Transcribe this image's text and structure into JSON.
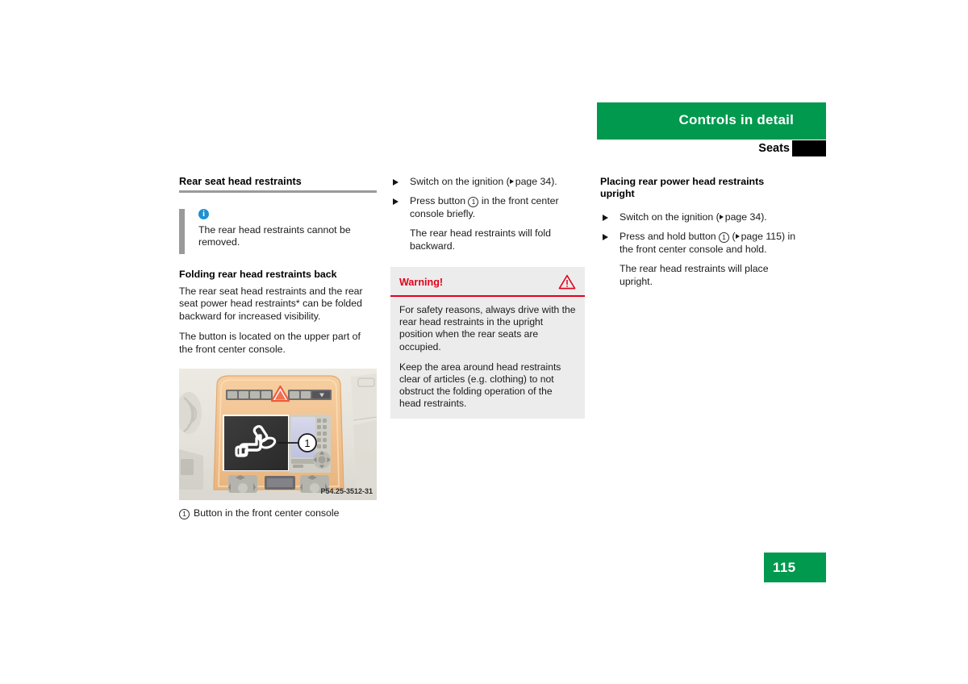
{
  "header": {
    "title": "Controls in detail",
    "subtitle": "Seats",
    "bar_color": "#00994d"
  },
  "left_column": {
    "section_title": "Rear seat head restraints",
    "note": {
      "icon": "info-icon",
      "text": "The rear head restraints cannot be removed."
    },
    "sub_title": "Folding rear head restraints back",
    "paragraph_1": "The rear seat head restraints and the rear seat power head restraints* can be folded backward for increased visibility.",
    "paragraph_2": "The button is located on the upper part of the front center console.",
    "figure": {
      "code": "P54.25-3512-31",
      "callout_number": "1",
      "caption_number": "1",
      "caption_text": "Button in the front center console"
    }
  },
  "middle_column": {
    "steps": [
      {
        "marker": "triangle-bullet",
        "text_before": "Switch on the ignition (",
        "ref": "page 34",
        "text_after": ")."
      },
      {
        "marker": "triangle-bullet",
        "text_before": "Press button ",
        "circled": "1",
        "text_after": " in the front center console briefly."
      }
    ],
    "result": "The rear head restraints will fold backward.",
    "warning": {
      "title": "Warning!",
      "icon": "warning-triangle-icon",
      "paragraph_1": "For safety reasons, always drive with the rear head restraints in the upright position when the rear seats are occupied.",
      "paragraph_2": "Keep the area around head restraints clear of articles (e.g. clothing) to not obstruct the folding operation of the head restraints.",
      "accent_color": "#e2001a"
    }
  },
  "right_column": {
    "sub_title": "Placing rear power head restraints upright",
    "steps": [
      {
        "marker": "triangle-bullet",
        "text_before": "Switch on the ignition (",
        "ref": "page 34",
        "text_after": ")."
      },
      {
        "marker": "triangle-bullet",
        "text_before": "Press and hold button ",
        "circled": "1",
        "text_middle": " (",
        "ref": "page 115",
        "text_after": ") in the front center console and hold."
      }
    ],
    "result": "The rear head restraints will place upright."
  },
  "footer": {
    "page_number": "115"
  }
}
